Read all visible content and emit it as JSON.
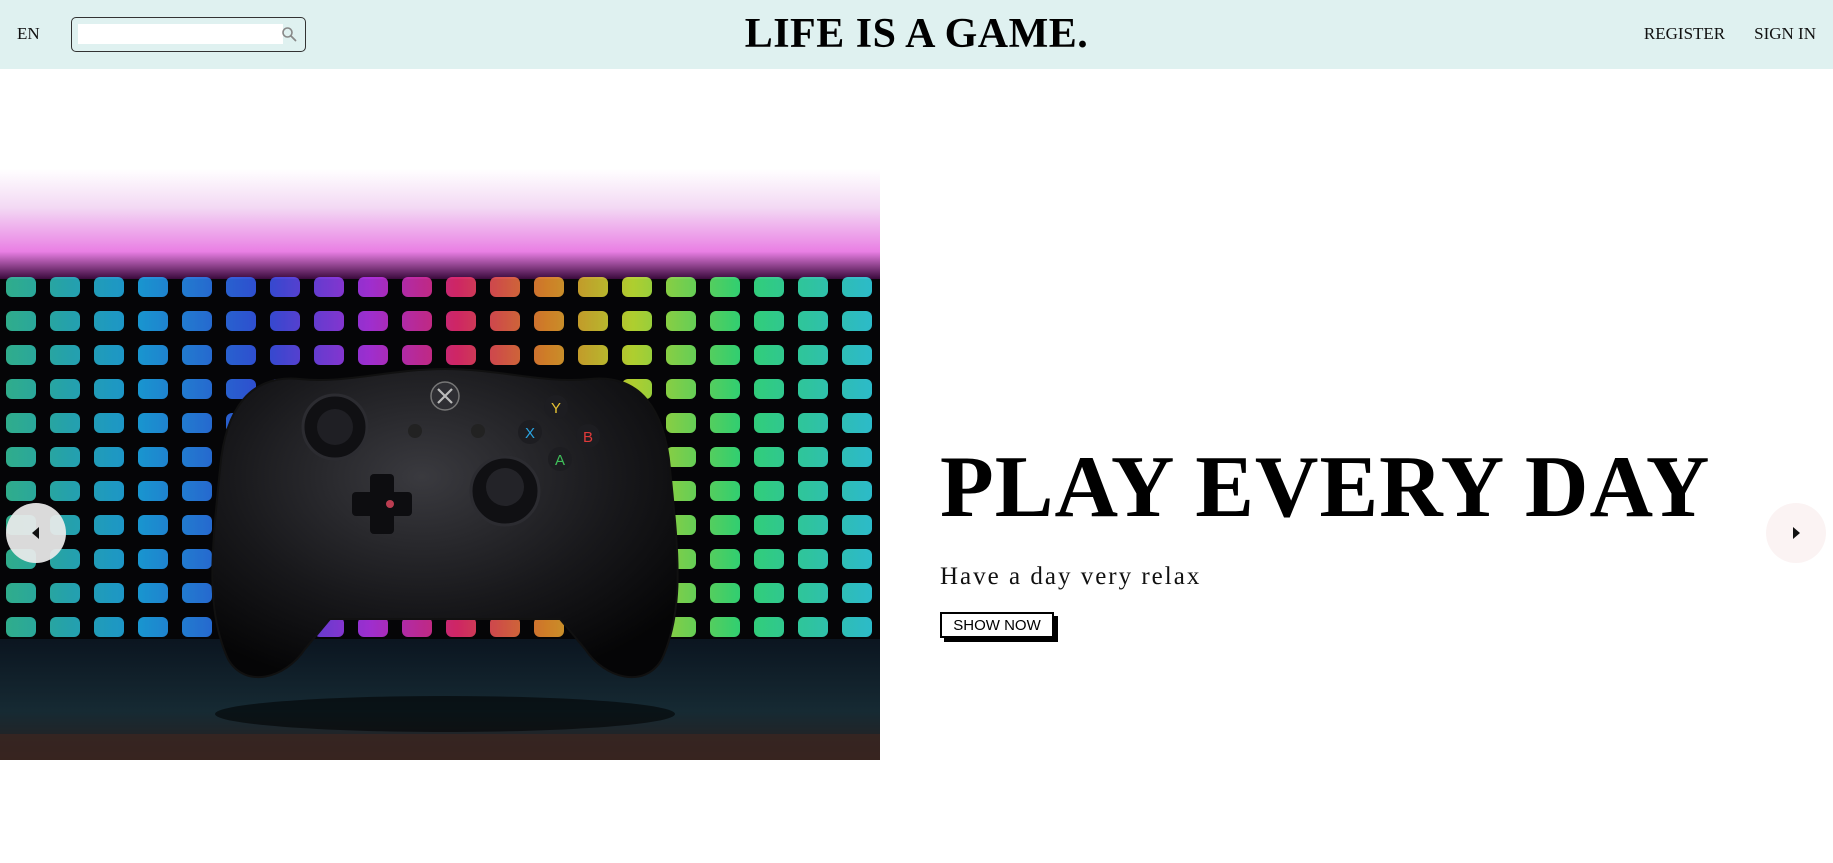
{
  "header": {
    "language": "EN",
    "search": {
      "value": "",
      "placeholder": ""
    },
    "brand": "LIFE IS A GAME.",
    "links": {
      "register": "REGISTER",
      "sign_in": "SIGN IN"
    }
  },
  "hero": {
    "title": "PLAY EVERY DAY",
    "subtitle": "Have a day very relax",
    "button_label": "SHOW NOW",
    "image_icon": "gamepad-on-rgb-keyboard-photo",
    "prev_icon": "caret-left-icon",
    "next_icon": "caret-right-icon"
  },
  "colors": {
    "navbar_bg": "#dff1f0",
    "text": "#000000",
    "page_bg": "#ffffff"
  }
}
